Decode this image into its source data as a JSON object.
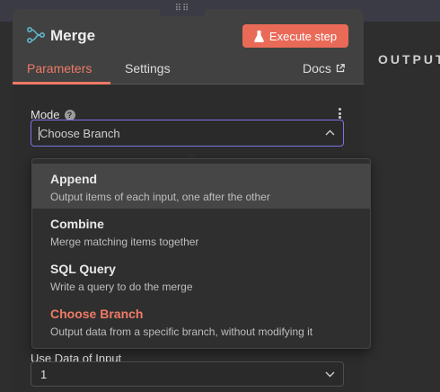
{
  "node": {
    "title": "Merge",
    "execute_label": "Execute step"
  },
  "tabs": [
    {
      "label": "Parameters",
      "active": true
    },
    {
      "label": "Settings",
      "active": false
    }
  ],
  "docs_label": "Docs",
  "output_label": "OUTPUT",
  "mode": {
    "label": "Mode",
    "value": "Choose Branch"
  },
  "dropdown": {
    "options": [
      {
        "title": "Append",
        "description": "Output items of each input, one after the other",
        "highlighted": true,
        "selected": false
      },
      {
        "title": "Combine",
        "description": "Merge matching items together",
        "highlighted": false,
        "selected": false
      },
      {
        "title": "SQL Query",
        "description": "Write a query to do the merge",
        "highlighted": false,
        "selected": false
      },
      {
        "title": "Choose Branch",
        "description": "Output data from a specific branch, without modifying it",
        "highlighted": false,
        "selected": true
      }
    ]
  },
  "use_data": {
    "label": "Use Data of Input",
    "value": "1"
  },
  "colors": {
    "accent": "#ea6a58",
    "focus_border": "#7d72e6",
    "selected_text": "#ef7a66",
    "node_icon": "#5fb6c9"
  },
  "icons": [
    "merge-node-icon",
    "flask-icon",
    "external-link-icon",
    "help-icon",
    "kebab-menu-icon",
    "chevron-up-icon",
    "chevron-down-icon",
    "drag-handle-icon"
  ]
}
